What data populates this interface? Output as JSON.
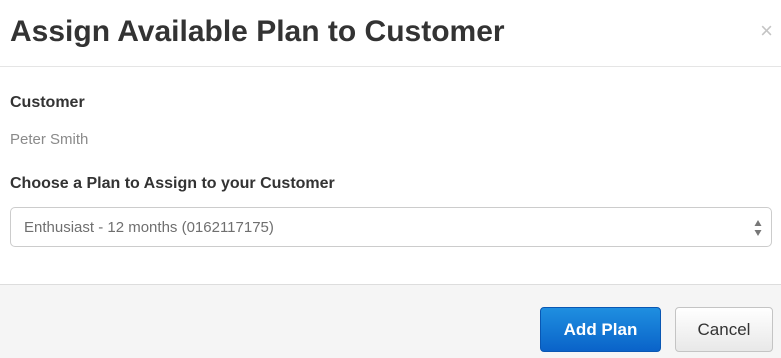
{
  "modal": {
    "title": "Assign Available Plan to Customer",
    "close_glyph": "×"
  },
  "body": {
    "customer_label": "Customer",
    "customer_name": "Peter Smith",
    "plan_label": "Choose a Plan to Assign to your Customer",
    "plan_select": {
      "selected": "Enthusiast - 12 months (0162117175)"
    }
  },
  "footer": {
    "add_plan_label": "Add Plan",
    "cancel_label": "Cancel"
  },
  "colors": {
    "primary_button": "#0a63c9",
    "footer_background": "#f5f5f5"
  },
  "icons": {
    "close": "close-icon",
    "select_arrows": "select-arrows-icon"
  }
}
